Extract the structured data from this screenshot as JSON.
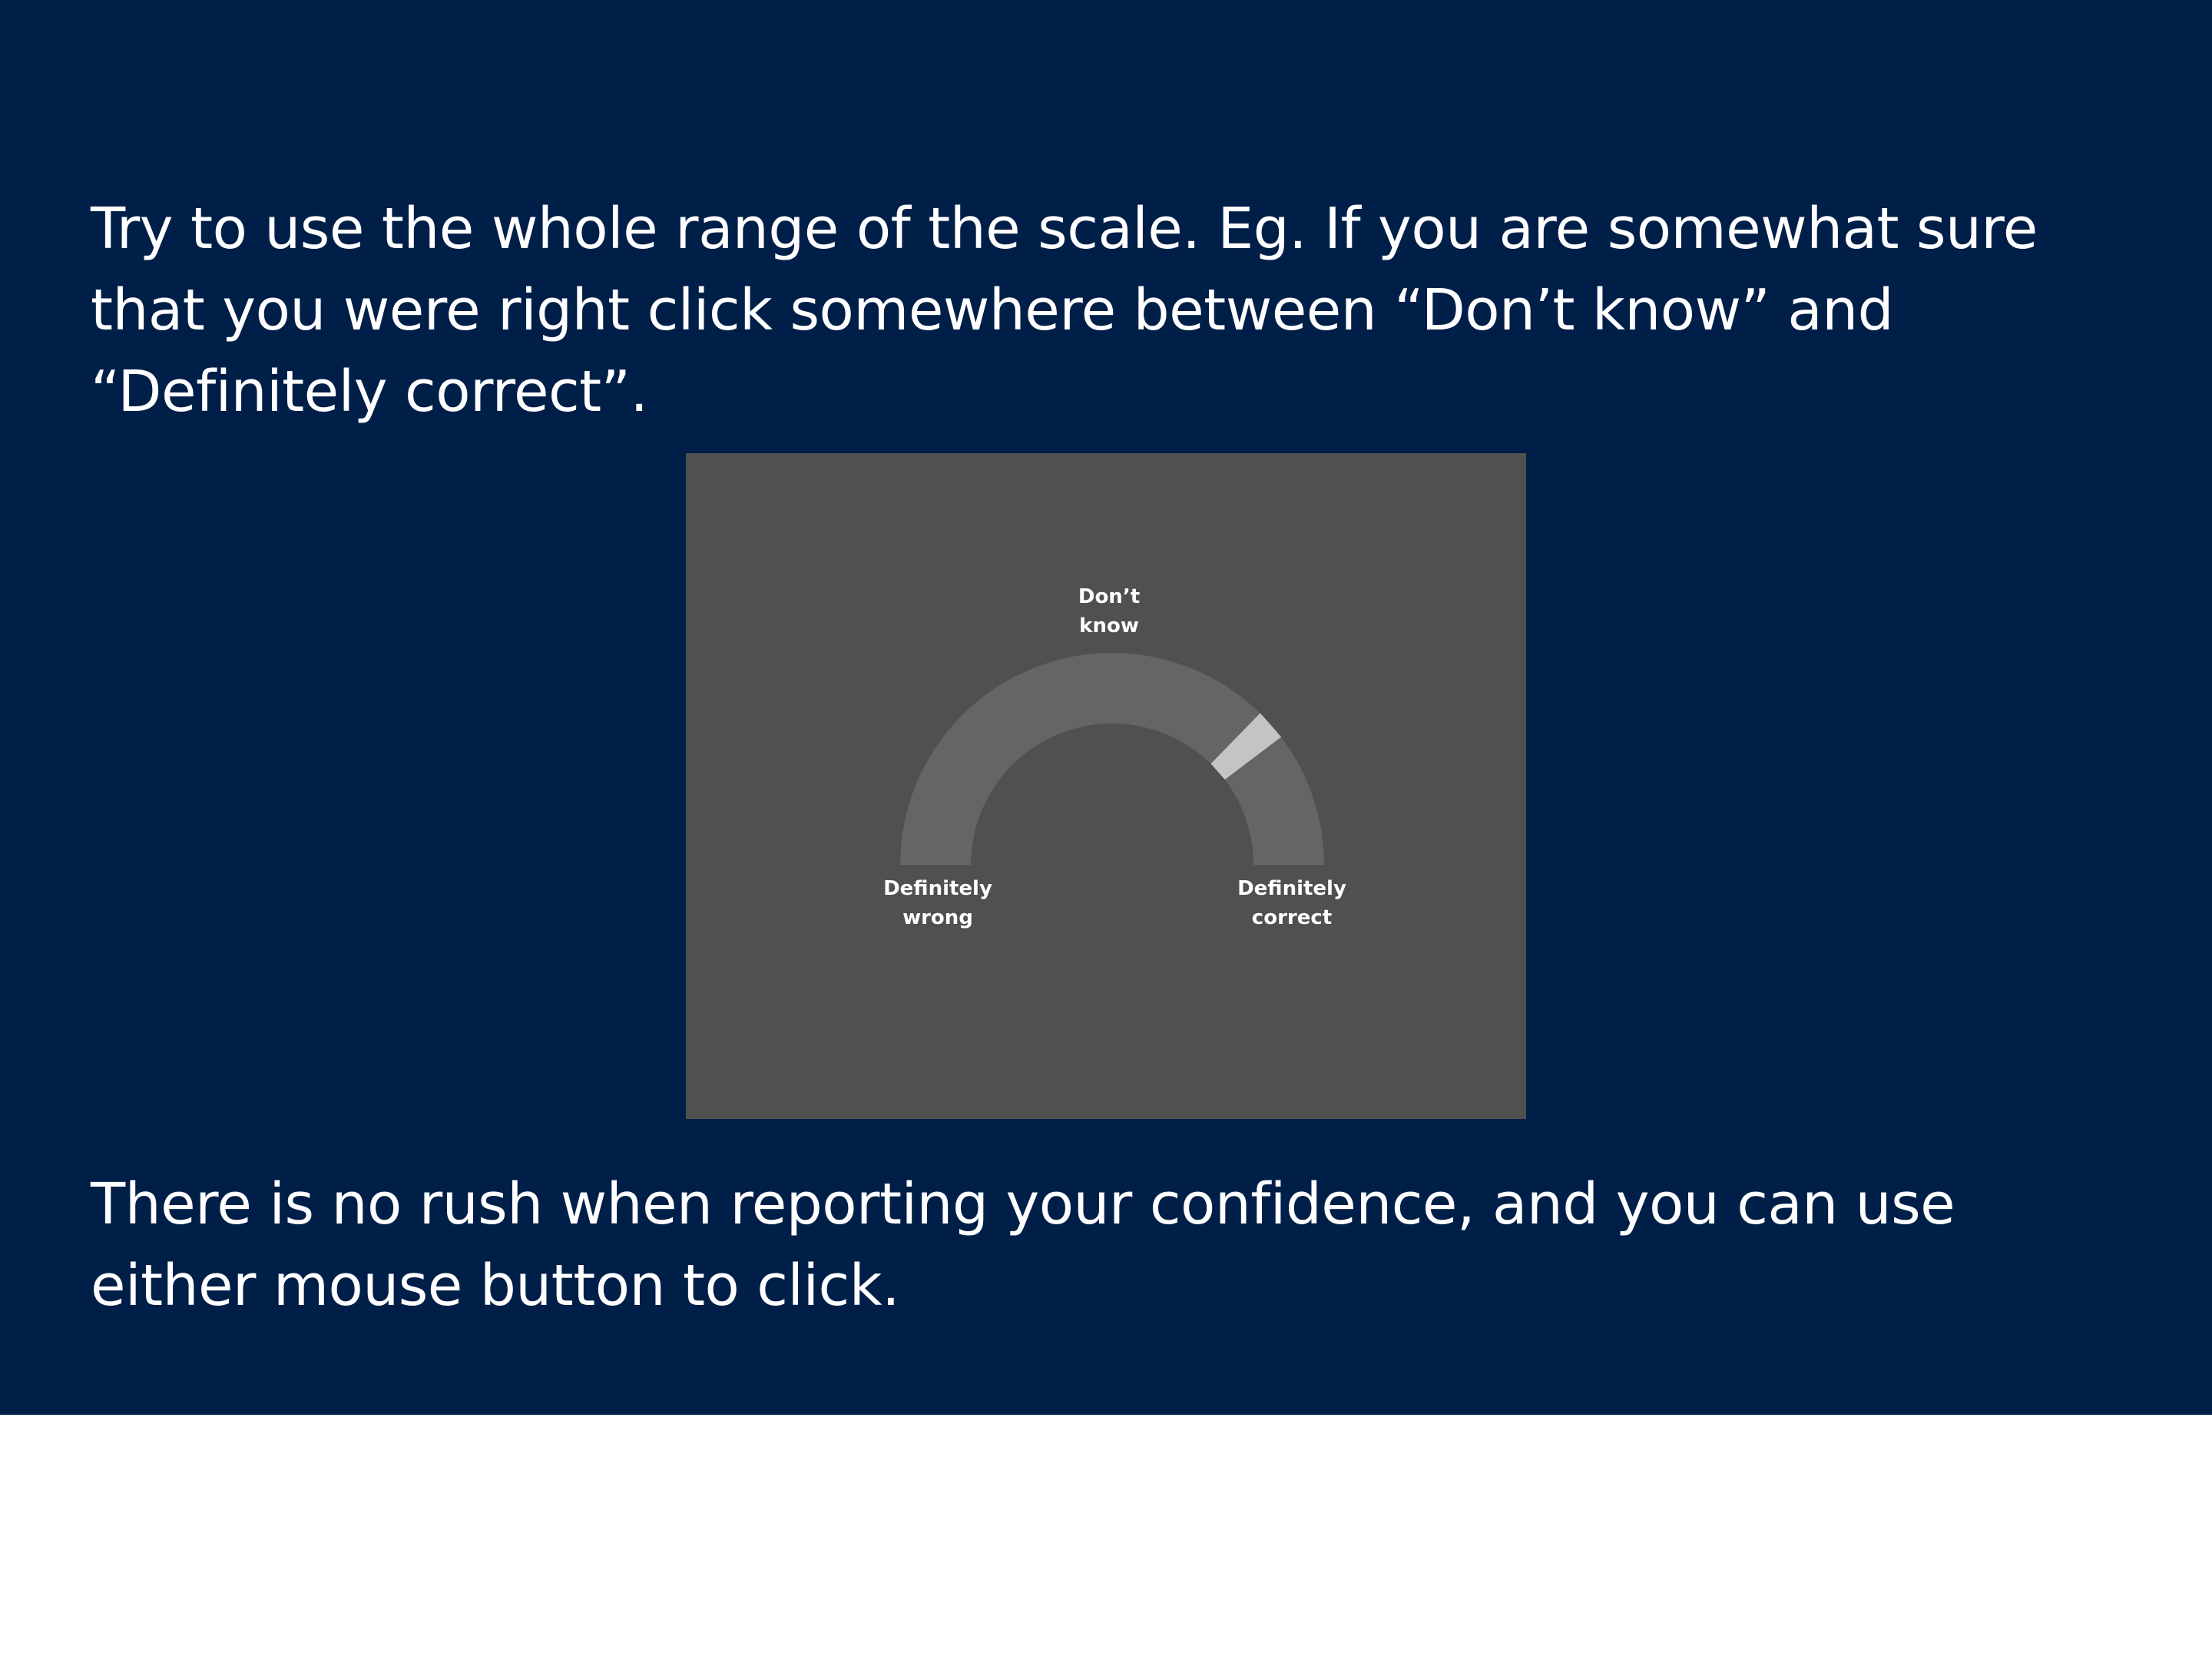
{
  "instructions": {
    "top_lines": [
      "Try to use the whole range of the scale. Eg. If you are somewhat sure",
      "that you were right click somewhere between “Don’t know” and",
      "“Definitely correct”."
    ],
    "bottom_lines": [
      "There is no rush when reporting your confidence, and you can use",
      "either mouse button to click."
    ]
  },
  "confidence_scale": {
    "labels": {
      "top": [
        "Don’t",
        "know"
      ],
      "left": [
        "Definitely",
        "wrong"
      ],
      "right": [
        "Definitely",
        "correct"
      ]
    },
    "marker_fraction": 0.77,
    "colors": {
      "panel": "#505050",
      "arc": "#656565",
      "marker": "#c4c4c4",
      "label": "#ffffff"
    }
  },
  "colors": {
    "slide_background": "#001f48",
    "page_background": "#ffffff",
    "text": "#ffffff"
  }
}
